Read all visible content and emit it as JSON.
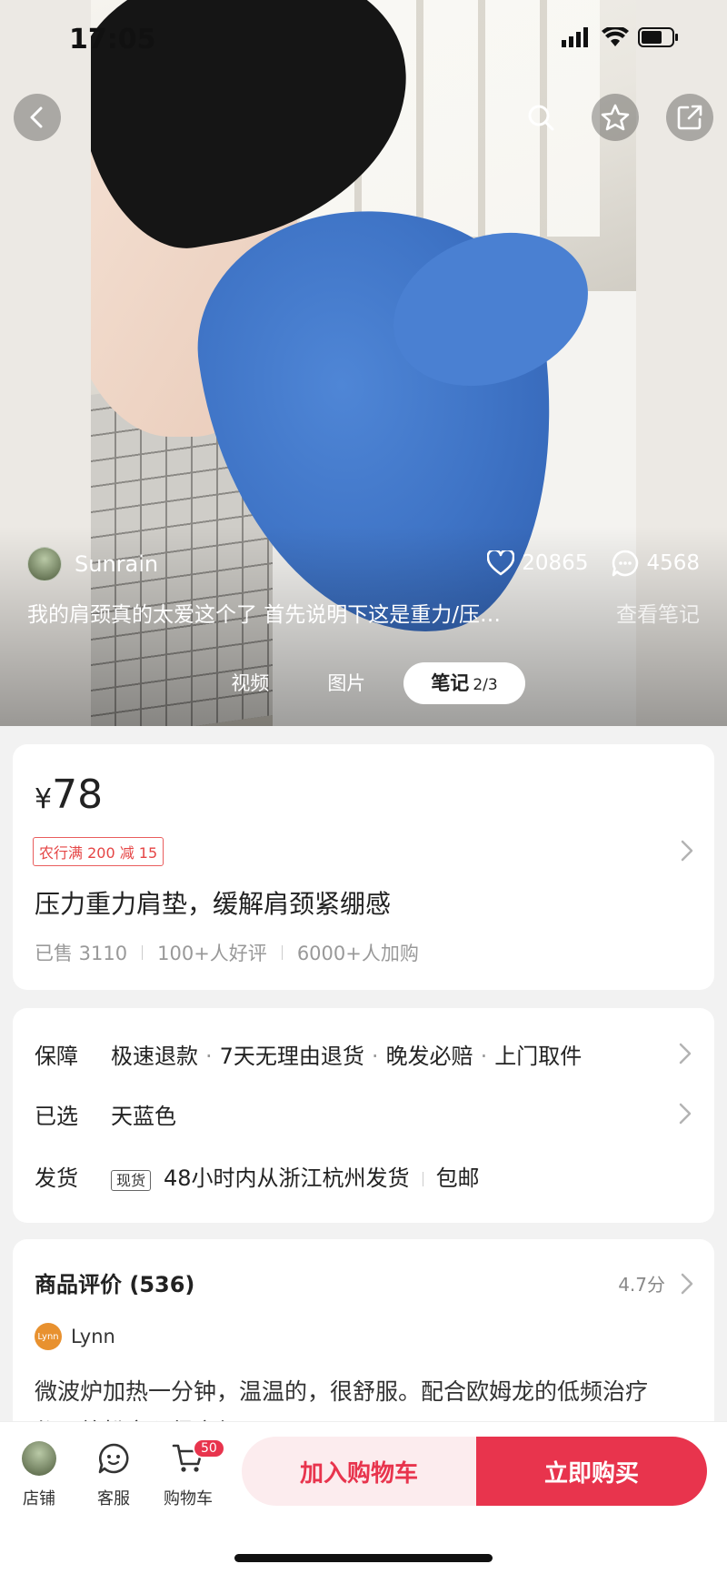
{
  "status_bar": {
    "time": "17:05"
  },
  "note": {
    "author": "Sunrain",
    "likes": "20865",
    "comments": "4568",
    "caption": "我的肩颈真的太爱这个了 首先说明下这是重力/压…",
    "view_note": "查看笔记",
    "tabs": [
      {
        "label": "视频"
      },
      {
        "label": "图片"
      },
      {
        "label": "笔记",
        "count": "2/3"
      }
    ]
  },
  "product": {
    "currency": "¥",
    "price": "78",
    "coupon": "农行满 200 减 15",
    "title": "压力重力肩垫，缓解肩颈紧绷感",
    "sold": "已售 3110",
    "good_reviews": "100+人好评",
    "added_to_cart": "6000+人加购"
  },
  "info": {
    "guarantee_label": "保障",
    "guarantees": [
      "极速退款",
      "7天无理由退货",
      "晚发必赔",
      "上门取件"
    ],
    "dot": "·",
    "selected_label": "已选",
    "selected_value": "天蓝色",
    "shipping_label": "发货",
    "shipping_badge": "现货",
    "shipping_text": "48小时内从浙江杭州发货",
    "shipping_free": "包邮"
  },
  "reviews": {
    "title": "商品评价 (536)",
    "score": "4.7分",
    "reviewer_name": "Lynn",
    "reviewer_avatar_text": "Lynn",
    "text": "微波炉加热一分钟，温温的，很舒服。配合欧姆龙的低频治疗仪，放松肩颈很方便"
  },
  "bottom_bar": {
    "shop": "店铺",
    "service": "客服",
    "cart": "购物车",
    "cart_count": "50",
    "add_to_cart": "加入购物车",
    "buy_now": "立即购买"
  },
  "colors": {
    "accent": "#e8344d",
    "accent_light": "#fcecee",
    "coupon_red": "#e54545"
  }
}
